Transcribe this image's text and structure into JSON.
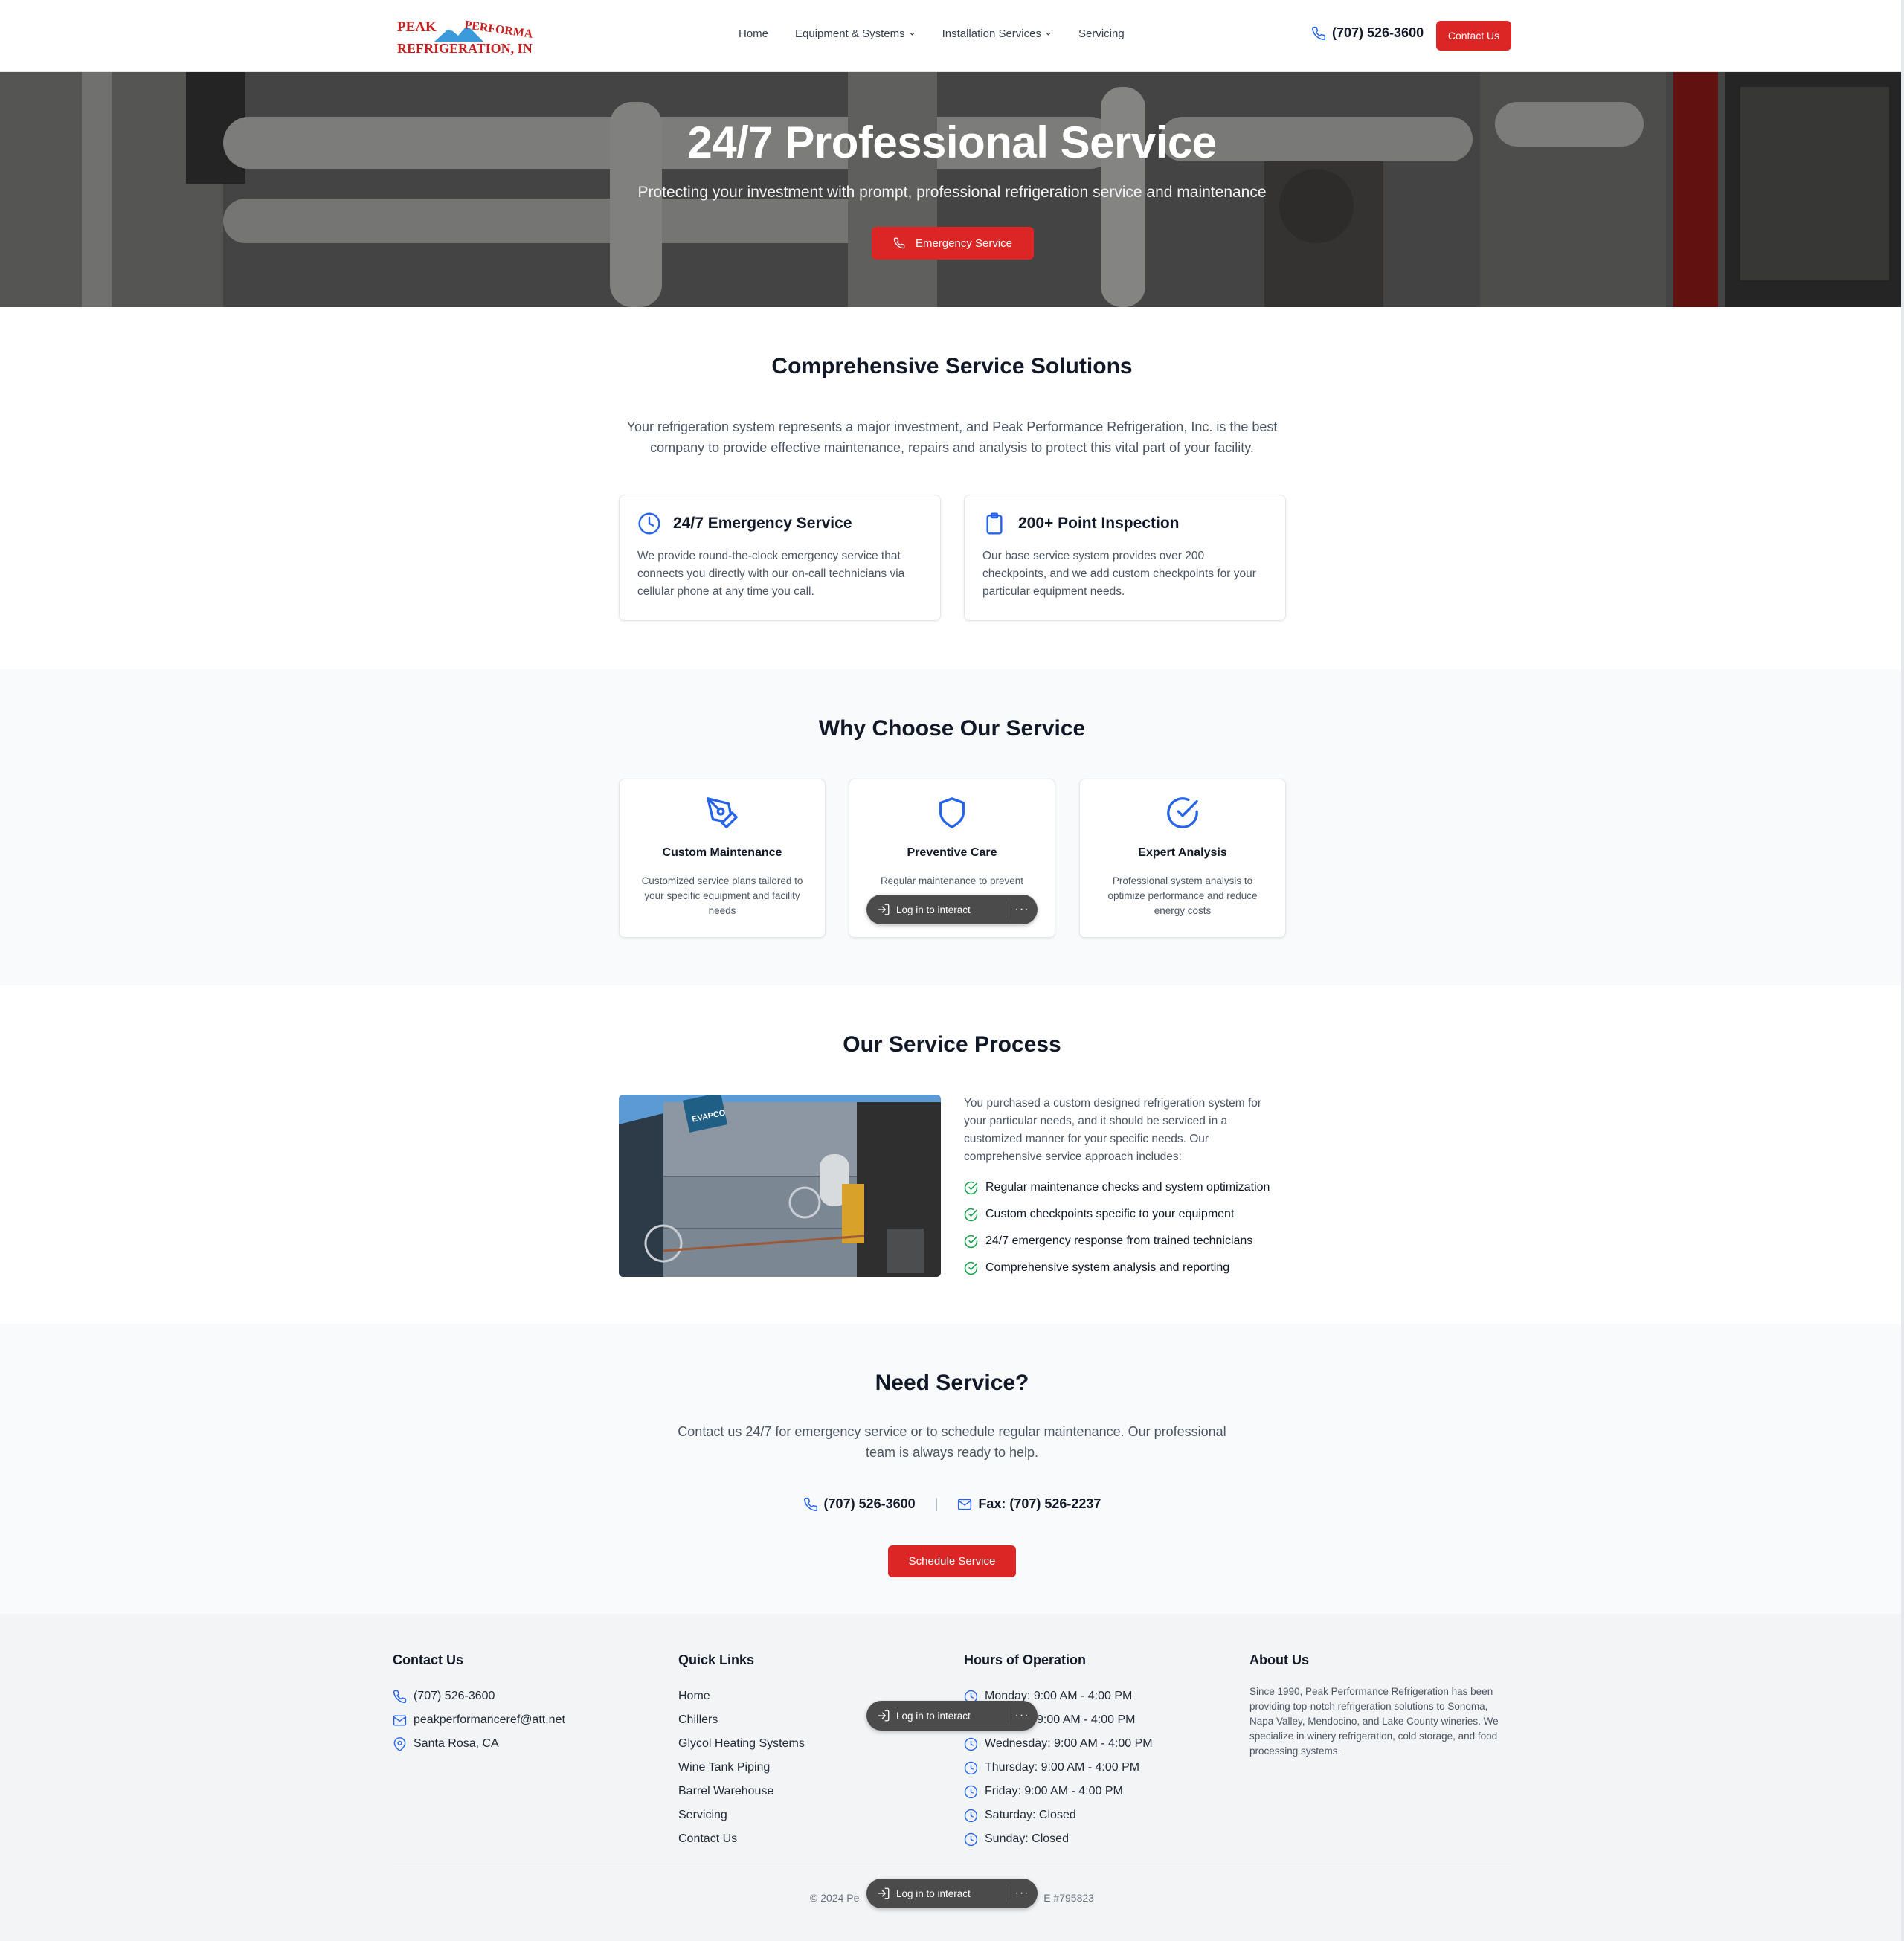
{
  "header": {
    "logo_line1": "Peak Performance",
    "logo_line2": "Refrigeration, Inc.",
    "nav": [
      {
        "label": "Home"
      },
      {
        "label": "Equipment & Systems"
      },
      {
        "label": "Installation Services"
      },
      {
        "label": "Servicing"
      }
    ],
    "phone": "(707) 526-3600",
    "contact_button": "Contact Us"
  },
  "hero": {
    "title": "24/7 Professional Service",
    "subtitle": "Protecting your investment with prompt, professional refrigeration service and maintenance",
    "button": "Emergency Service"
  },
  "solutions": {
    "title": "Comprehensive Service Solutions",
    "lead": "Your refrigeration system represents a major investment, and Peak Performance Refrigeration, Inc. is the best company to provide effective maintenance, repairs and analysis to protect this vital part of your facility.",
    "cards": [
      {
        "icon": "clock-icon",
        "title": "24/7 Emergency Service",
        "text": "We provide round-the-clock emergency service that connects you directly with our on-call technicians via cellular phone at any time you call."
      },
      {
        "icon": "clipboard-icon",
        "title": "200+ Point Inspection",
        "text": "Our base service system provides over 200 checkpoints, and we add custom checkpoints for your particular equipment needs."
      }
    ]
  },
  "why": {
    "title": "Why Choose Our Service",
    "cards": [
      {
        "icon": "pen-tool-icon",
        "title": "Custom Maintenance",
        "text": "Customized service plans tailored to your specific equipment and facility needs"
      },
      {
        "icon": "shield-icon",
        "title": "Preventive Care",
        "text": "Regular maintenance to prevent"
      },
      {
        "icon": "check-circle-icon",
        "title": "Expert Analysis",
        "text": "Professional system analysis to optimize performance and reduce energy costs"
      }
    ]
  },
  "process": {
    "title": "Our Service Process",
    "image_brand": "EVAPCO",
    "text": "You purchased a custom designed refrigeration system for your particular needs, and it should be serviced in a customized manner for your specific needs. Our comprehensive service approach includes:",
    "items": [
      "Regular maintenance checks and system optimization",
      "Custom checkpoints specific to your equipment",
      "24/7 emergency response from trained technicians",
      "Comprehensive system analysis and reporting"
    ]
  },
  "need": {
    "title": "Need Service?",
    "lead": "Contact us 24/7 for emergency service or to schedule regular maintenance. Our professional team is always ready to help.",
    "phone": "(707) 526-3600",
    "separator": "|",
    "fax": "Fax: (707) 526-2237",
    "button": "Schedule Service"
  },
  "footer": {
    "contact": {
      "title": "Contact Us",
      "phone": "(707) 526-3600",
      "email": "peakperformanceref@att.net",
      "location": "Santa Rosa, CA"
    },
    "links": {
      "title": "Quick Links",
      "items": [
        "Home",
        "Chillers",
        "Glycol Heating Systems",
        "Wine Tank Piping",
        "Barrel Warehouse",
        "Servicing",
        "Contact Us"
      ]
    },
    "hours": {
      "title": "Hours of Operation",
      "items": [
        "Monday: 9:00 AM - 4:00 PM",
        "9:00 AM - 4:00 PM",
        "Wednesday: 9:00 AM - 4:00 PM",
        "Thursday: 9:00 AM - 4:00 PM",
        "Friday: 9:00 AM - 4:00 PM",
        "Saturday: Closed",
        "Sunday: Closed"
      ]
    },
    "about": {
      "title": "About Us",
      "text": "Since 1990, Peak Performance Refrigeration has been providing top-notch refrigeration solutions to Sonoma, Napa Valley, Mendocino, and Lake County wineries. We specialize in winery refrigeration, cold storage, and food processing systems."
    },
    "copyright_left": "© 2024 Pe",
    "copyright_right": "E #795823"
  },
  "overlay": {
    "pill_label": "Log in to interact",
    "pill_more": "···"
  },
  "colors": {
    "accent_red": "#dc2626",
    "icon_blue": "#2563eb",
    "check_green": "#16a34a",
    "section_gray": "#f9fafb"
  }
}
